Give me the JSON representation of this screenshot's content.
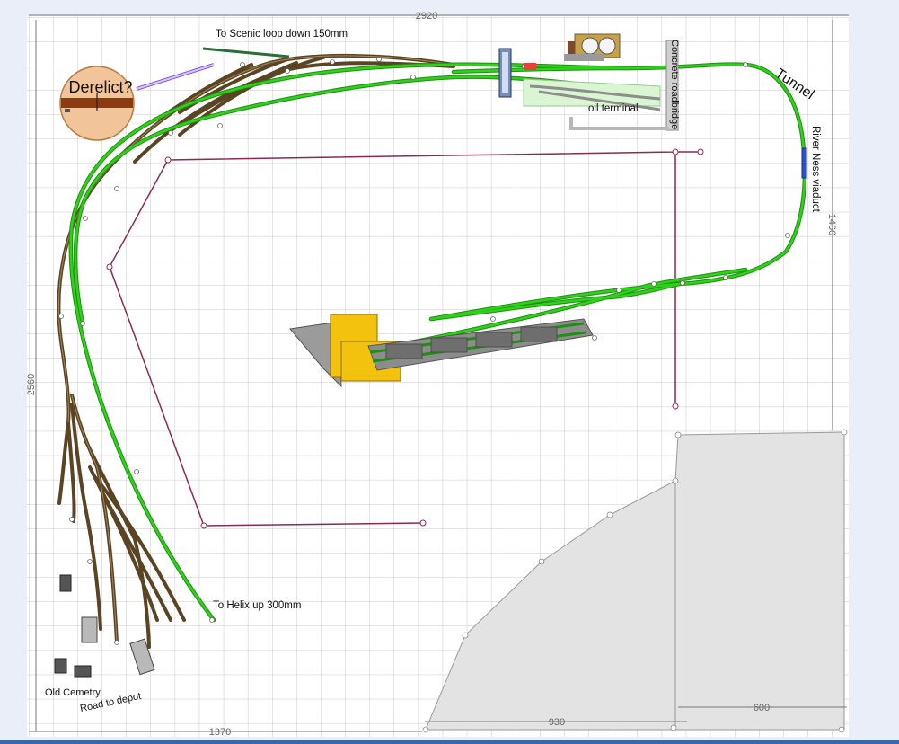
{
  "labels": {
    "scenic_loop": "To Scenic loop down 150mm",
    "derelict": "Derelict?",
    "concrete_roadbridge": "Concrete roadbridge",
    "oil_terminal": "oil terminal",
    "tunnel": "Tunnel",
    "river_ness_viaduct": "River Ness viaduct",
    "helix": "To Helix up 300mm",
    "old_cemetery": "Old Cemetry",
    "road_to_depot": "Road to depot"
  },
  "dimensions": {
    "width_total": "2920",
    "height_total": "2560",
    "right_height": "1460",
    "bottom_left": "1370",
    "bottom_mid": "930",
    "bottom_right": "600"
  },
  "colors": {
    "mainline_track": "#2fd11b",
    "siding_track": "#5b4423",
    "baseboard_outline": "#8b2a55",
    "grid": "#c9c9c9",
    "shaded_area": "#e3e3e3",
    "viaduct": "#2b4fd6",
    "station_building": "#f3c20f",
    "turntable": "#f1c49a"
  }
}
